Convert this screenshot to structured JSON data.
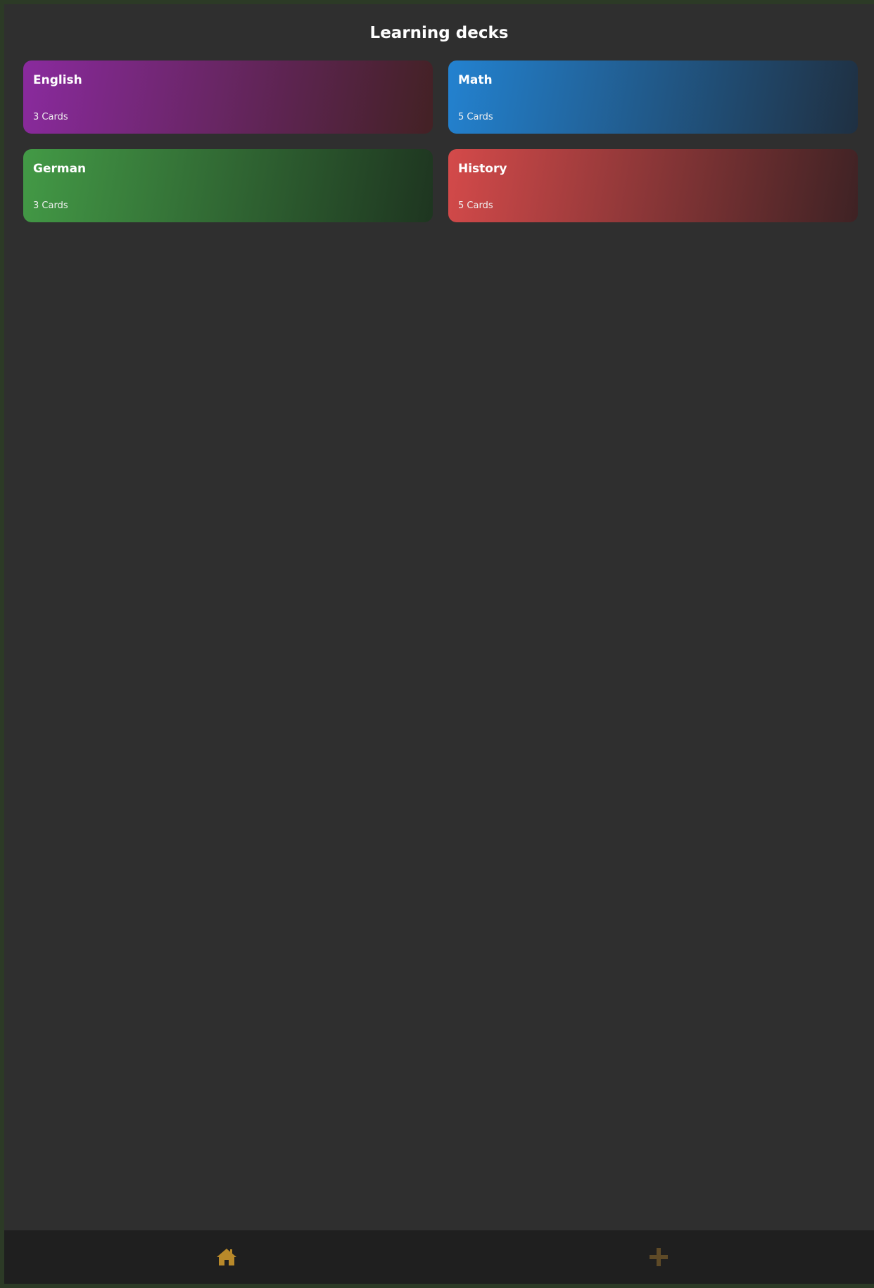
{
  "header": {
    "title": "Learning decks"
  },
  "decks": [
    {
      "name": "English",
      "count": "3 Cards",
      "color_start": "#8a2a9e",
      "color_end": "#432124"
    },
    {
      "name": "Math",
      "count": "5 Cards",
      "color_start": "#2382d0",
      "color_end": "#1f3042"
    },
    {
      "name": "German",
      "count": "3 Cards",
      "color_start": "#439a46",
      "color_end": "#1e3520"
    },
    {
      "name": "History",
      "count": "5 Cards",
      "color_start": "#d44a4a",
      "color_end": "#3e2224"
    }
  ],
  "nav": {
    "home_icon": "home-icon",
    "add_icon": "plus-icon",
    "home_color": "#b8892a",
    "add_color": "#5e4a27"
  },
  "colors": {
    "background": "#2f2f2f",
    "nav_background": "#1f1f1f",
    "frame": "#2c3a26"
  }
}
